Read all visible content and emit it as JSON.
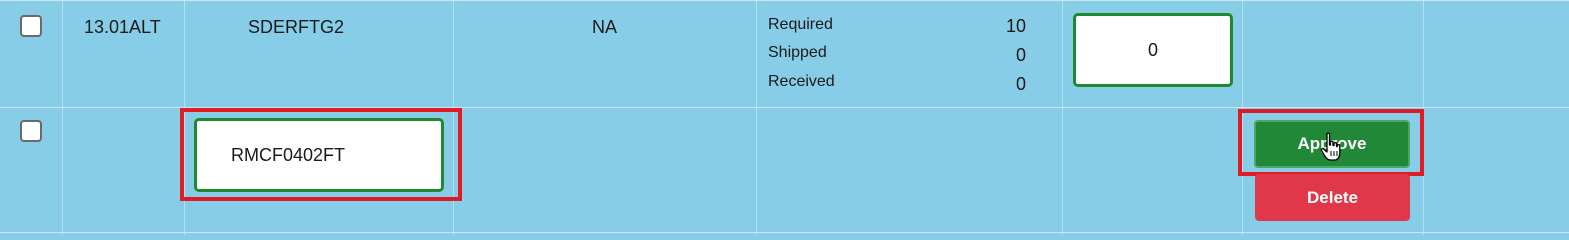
{
  "row1": {
    "item_number": "13.01ALT",
    "part_code": "SDERFTG2",
    "status": "NA",
    "quantities": [
      {
        "label": "Required",
        "value": "10"
      },
      {
        "label": "Shipped",
        "value": "0"
      },
      {
        "label": "Received",
        "value": "0"
      }
    ],
    "quantity_input_value": "0"
  },
  "row2": {
    "part_input_value": "RMCF0402FT",
    "approve_label": "Approve",
    "delete_label": "Delete"
  },
  "colors": {
    "table_background": "#87cde8",
    "input_border": "#1e8a2e",
    "approve": "#218838",
    "delete": "#e0384a",
    "highlight": "#e01b24"
  },
  "icons": {
    "cursor": "hand-pointer-icon"
  }
}
